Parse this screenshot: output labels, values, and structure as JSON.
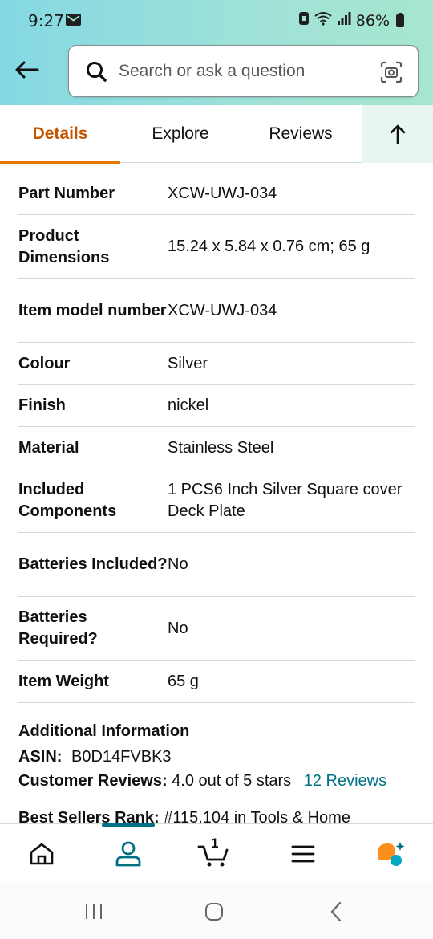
{
  "status_bar": {
    "time": "9:27",
    "battery": "86%"
  },
  "search": {
    "placeholder": "Search or ask a question"
  },
  "tabs": {
    "details": "Details",
    "explore": "Explore",
    "reviews": "Reviews"
  },
  "specs": [
    {
      "key": "Part Number",
      "value": "XCW-UWJ-034"
    },
    {
      "key": "Product Dimensions",
      "value": "15.24 x 5.84 x 0.76 cm; 65 g"
    },
    {
      "key": "Item model number",
      "value": "XCW-UWJ-034"
    },
    {
      "key": "Colour",
      "value": "Silver"
    },
    {
      "key": "Finish",
      "value": "nickel"
    },
    {
      "key": "Material",
      "value": "Stainless Steel"
    },
    {
      "key": "Included Components",
      "value": "1 PCS6 Inch Silver Square cover Deck Plate"
    },
    {
      "key": "Batteries Included?",
      "value": "No"
    },
    {
      "key": "Batteries Required?",
      "value": "No"
    },
    {
      "key": "Item Weight",
      "value": "65 g"
    }
  ],
  "additional": {
    "title": "Additional Information",
    "asin_label": "ASIN:",
    "asin_value": "B0D14FVBK3",
    "reviews_label": "Customer Reviews:",
    "reviews_value": "4.0 out of 5 stars",
    "reviews_count": "12",
    "reviews_link": "Reviews",
    "best_sellers_label": "Best Sellers Rank:",
    "best_sellers_value": "#115,104 in Tools & Home"
  },
  "bottom_nav": {
    "cart_count": "1",
    "accent_color": "#007185"
  },
  "colors": {
    "active_tab": "#c45500",
    "active_underline": "#e77600",
    "link": "#007185"
  }
}
